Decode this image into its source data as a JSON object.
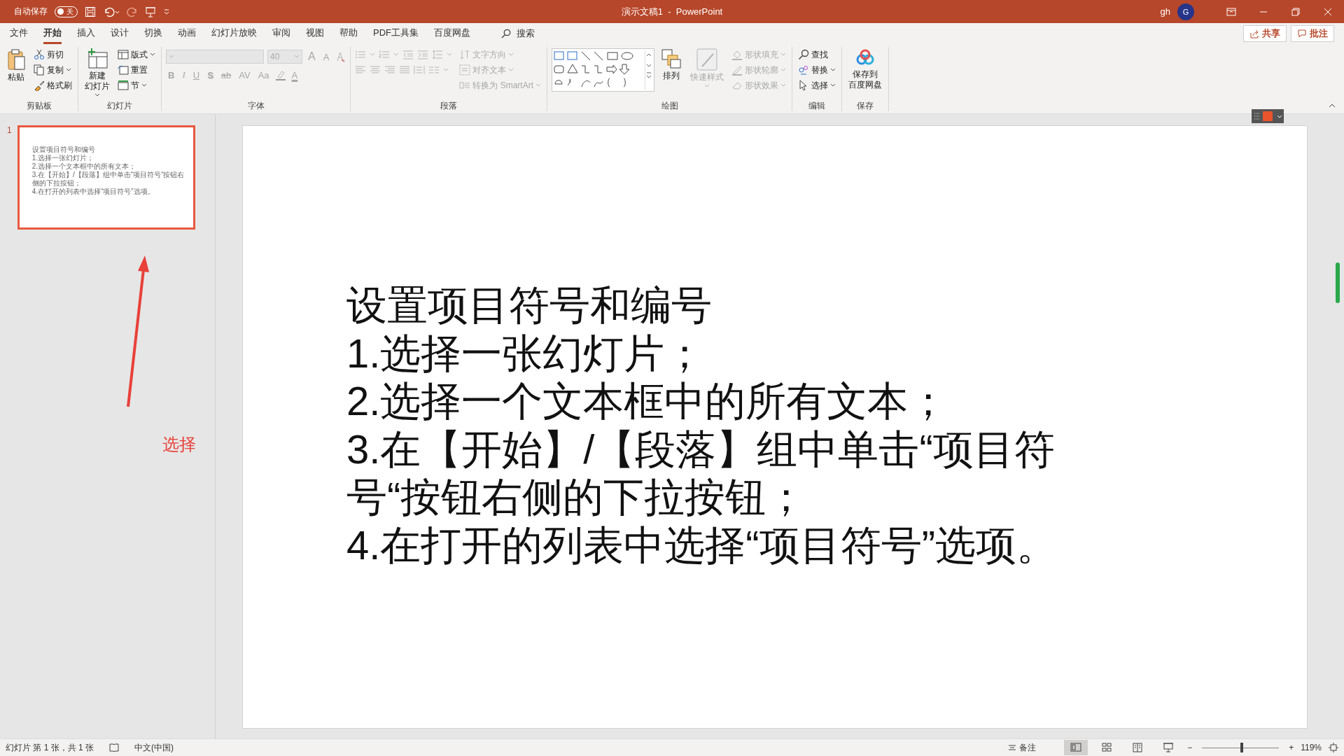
{
  "title_bar": {
    "autosave_label": "自动保存",
    "autosave": {
      "label": "关",
      "on": false
    },
    "document_title": "演示文稿1  -  PowerPoint",
    "user": "gh",
    "avatar_initial": "G"
  },
  "menu_tabs": [
    {
      "label": "文件",
      "selected": false
    },
    {
      "label": "开始",
      "selected": true
    },
    {
      "label": "插入",
      "selected": false
    },
    {
      "label": "设计",
      "selected": false
    },
    {
      "label": "切换",
      "selected": false
    },
    {
      "label": "动画",
      "selected": false
    },
    {
      "label": "幻灯片放映",
      "selected": false
    },
    {
      "label": "审阅",
      "selected": false
    },
    {
      "label": "视图",
      "selected": false
    },
    {
      "label": "帮助",
      "selected": false
    },
    {
      "label": "PDF工具集",
      "selected": false
    },
    {
      "label": "百度网盘",
      "selected": false
    }
  ],
  "search_label": "搜索",
  "share_button": "共享",
  "comments_button": "批注",
  "ribbon": [
    {
      "title": "剪贴板",
      "kind": "clipboard",
      "items": [
        {
          "label": "粘贴",
          "kind": "large",
          "disabled": false
        },
        {
          "label": "剪切",
          "kind": "small",
          "disabled": false
        },
        {
          "label": "复制",
          "kind": "small",
          "disabled": false
        },
        {
          "label": "格式刷",
          "kind": "small",
          "disabled": false
        }
      ]
    },
    {
      "title": "幻灯片",
      "kind": "slides",
      "items": [
        {
          "lines": [
            "新建",
            "幻灯片"
          ],
          "kind": "large",
          "disabled": false
        },
        {
          "label": "版式",
          "kind": "small",
          "disabled": false
        },
        {
          "label": "重置",
          "kind": "small",
          "disabled": false
        },
        {
          "label": "节",
          "kind": "small",
          "disabled": false
        }
      ]
    },
    {
      "title": "字体",
      "kind": "font",
      "font_size": "40",
      "disabled": true,
      "items": [
        {
          "label": "A",
          "kind": "grow",
          "disabled": true
        },
        {
          "label": "A",
          "kind": "shrink",
          "disabled": true
        },
        {
          "label": "B",
          "kind": "bold",
          "disabled": true
        },
        {
          "label": "I",
          "kind": "italic",
          "disabled": true
        },
        {
          "label": "U",
          "kind": "underline",
          "disabled": true
        },
        {
          "label": "S",
          "kind": "shadow",
          "disabled": true
        },
        {
          "label": "ab",
          "kind": "strike",
          "disabled": true
        },
        {
          "label": "AV",
          "kind": "spacing",
          "disabled": true
        },
        {
          "label": "Aa",
          "kind": "case",
          "disabled": true
        },
        {
          "label": "A",
          "kind": "color",
          "disabled": true
        }
      ]
    },
    {
      "title": "段落",
      "kind": "paragraph",
      "items": [
        {
          "label": "文字方向",
          "kind": "small",
          "disabled": true
        },
        {
          "label": "对齐文本",
          "kind": "small",
          "disabled": true
        },
        {
          "label": "转换为 SmartArt",
          "kind": "small",
          "disabled": true
        }
      ]
    },
    {
      "title": "绘图",
      "kind": "drawing",
      "items": [
        {
          "label": "排列",
          "kind": "large",
          "disabled": false
        },
        {
          "label": "快速样式",
          "kind": "large",
          "disabled": true
        },
        {
          "label": "形状填充",
          "kind": "small",
          "disabled": true
        },
        {
          "label": "形状轮廓",
          "kind": "small",
          "disabled": true
        },
        {
          "label": "形状效果",
          "kind": "small",
          "disabled": true
        }
      ]
    },
    {
      "title": "编辑",
      "kind": "editing",
      "items": [
        {
          "label": "查找",
          "kind": "small",
          "disabled": false
        },
        {
          "label": "替换",
          "kind": "small",
          "disabled": false
        },
        {
          "label": "选择",
          "kind": "small",
          "disabled": false
        }
      ]
    },
    {
      "title": "保存",
      "kind": "save",
      "items": [
        {
          "lines": [
            "保存到",
            "百度网盘"
          ],
          "kind": "large",
          "disabled": false
        }
      ]
    }
  ],
  "slides_panel": {
    "slides": [
      {
        "number": "1",
        "selected": true,
        "lines": [
          "设置项目符号和编号",
          "1.选择一张幻灯片；",
          "2.选择一个文本框中的所有文本；",
          "3.在【开始】/【段落】组中单击“项目符号“按钮右侧的下拉按钮；",
          "4.在打开的列表中选择“项目符号”选项。"
        ]
      }
    ],
    "annotation": "选择"
  },
  "slide": {
    "paragraphs": [
      "设置项目符号和编号",
      "1.选择一张幻灯片；",
      "2.选择一个文本框中的所有文本；",
      "3.在【开始】/【段落】组中单击“项目符号“按钮右侧的下拉按钮；",
      "4.在打开的列表中选择“项目符号”选项。"
    ]
  },
  "status_bar": {
    "slide_info": "幻灯片 第 1 张，共 1 张",
    "language": "中文(中国)",
    "notes": "备注",
    "views": [
      {
        "kind": "normal",
        "selected": true
      },
      {
        "kind": "sorter",
        "selected": false
      },
      {
        "kind": "reading",
        "selected": false
      },
      {
        "kind": "show",
        "selected": false
      }
    ],
    "zoom": {
      "minus": "−",
      "plus": "+",
      "level": 0.52,
      "reading": "119%"
    }
  }
}
